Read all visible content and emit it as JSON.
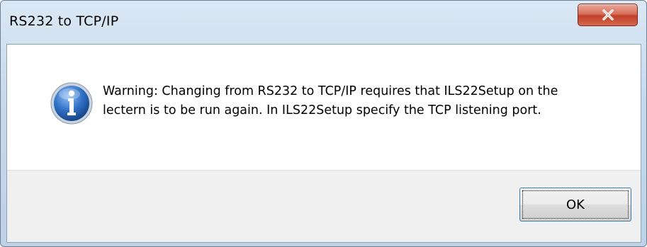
{
  "window": {
    "title": "RS232 to TCP/IP"
  },
  "dialog": {
    "icon": "information-icon",
    "message": "Warning: Changing from RS232 to TCP/IP requires that ILS22Setup on the lectern is to be run again. In ILS22Setup specify the TCP listening port.",
    "ok_label": "OK"
  },
  "colors": {
    "close_button": "#c7442f",
    "info_icon": "#2f6fc4",
    "footer_bg": "#f0f0f0",
    "titlebar": "#c7d9ec"
  }
}
